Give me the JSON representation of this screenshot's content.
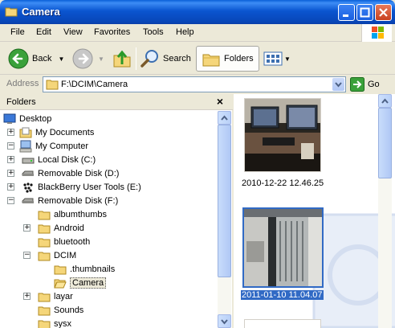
{
  "window": {
    "title": "Camera",
    "title_icon": "folder-icon",
    "controls": [
      "minimize",
      "maximize",
      "close"
    ]
  },
  "menubar": {
    "items": [
      {
        "label": "File"
      },
      {
        "label": "Edit"
      },
      {
        "label": "View"
      },
      {
        "label": "Favorites"
      },
      {
        "label": "Tools"
      },
      {
        "label": "Help"
      }
    ]
  },
  "toolbar": {
    "back_label": "Back",
    "search_label": "Search",
    "folders_label": "Folders"
  },
  "addressbar": {
    "label": "Address",
    "path": "F:\\DCIM\\Camera",
    "go_label": "Go"
  },
  "folder_pane": {
    "title": "Folders",
    "close_glyph": "×",
    "tree": [
      {
        "label": "Desktop",
        "icon": "desktop-icon",
        "depth": 0,
        "expander": ""
      },
      {
        "label": "My Documents",
        "icon": "documents-icon",
        "depth": 1,
        "expander": "+"
      },
      {
        "label": "My Computer",
        "icon": "computer-icon",
        "depth": 1,
        "expander": "−"
      },
      {
        "label": "Local Disk (C:)",
        "icon": "disk-icon",
        "depth": 2,
        "expander": "+"
      },
      {
        "label": "Removable Disk (D:)",
        "icon": "removable-disk-icon",
        "depth": 2,
        "expander": "+"
      },
      {
        "label": "BlackBerry User Tools (E:)",
        "icon": "blackberry-icon",
        "depth": 2,
        "expander": "+"
      },
      {
        "label": "Removable Disk (F:)",
        "icon": "removable-disk-icon",
        "depth": 2,
        "expander": "−"
      },
      {
        "label": "albumthumbs",
        "icon": "folder-icon",
        "depth": 3,
        "expander": ""
      },
      {
        "label": "Android",
        "icon": "folder-icon",
        "depth": 3,
        "expander": "+"
      },
      {
        "label": "bluetooth",
        "icon": "folder-icon",
        "depth": 3,
        "expander": ""
      },
      {
        "label": "DCIM",
        "icon": "folder-icon",
        "depth": 3,
        "expander": "−"
      },
      {
        "label": ".thumbnails",
        "icon": "folder-icon",
        "depth": 4,
        "expander": ""
      },
      {
        "label": "Camera",
        "icon": "folder-open-icon",
        "depth": 4,
        "expander": "",
        "selected": true
      },
      {
        "label": "layar",
        "icon": "folder-icon",
        "depth": 3,
        "expander": "+"
      },
      {
        "label": "Sounds",
        "icon": "folder-icon",
        "depth": 3,
        "expander": ""
      },
      {
        "label": "sysx",
        "icon": "folder-icon",
        "depth": 3,
        "expander": ""
      }
    ]
  },
  "content": {
    "thumbnails": [
      {
        "caption": "2010-12-22 12.46.25",
        "selected": false
      },
      {
        "caption": "2011-01-10 11.04.07",
        "selected": true
      }
    ]
  },
  "colors": {
    "titlebar": "#0a55d0",
    "selection": "#316ac5",
    "chrome": "#ece9d8"
  }
}
